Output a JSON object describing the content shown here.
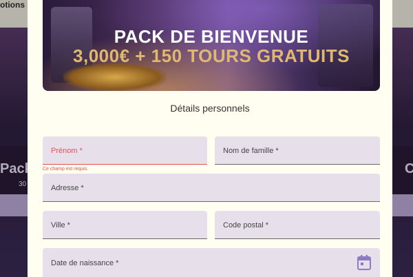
{
  "background": {
    "nav_text": "otions",
    "pack_left_title": "Pack",
    "pack_left_sub": "30",
    "pack_right_title": "C"
  },
  "banner": {
    "title": "PACK DE BIENVENUE",
    "subtitle": "3,000€ + 150 TOURS GRATUITS"
  },
  "form": {
    "section_title": "Détails personnels",
    "first_name_label": "Prénom *",
    "first_name_error": "Ce champ est requis.",
    "last_name_label": "Nom de famille *",
    "address_label": "Adresse *",
    "city_label": "Ville *",
    "postal_code_label": "Code postal *",
    "birthdate_label": "Date de naissance *",
    "birthdate_icon": "calendar-icon"
  },
  "colors": {
    "modal_bg": "#fffef0",
    "field_bg": "#e7e0ea",
    "error": "#e05252",
    "accent_gold": "#e0b871",
    "icon_purple": "#8c7bc9"
  }
}
